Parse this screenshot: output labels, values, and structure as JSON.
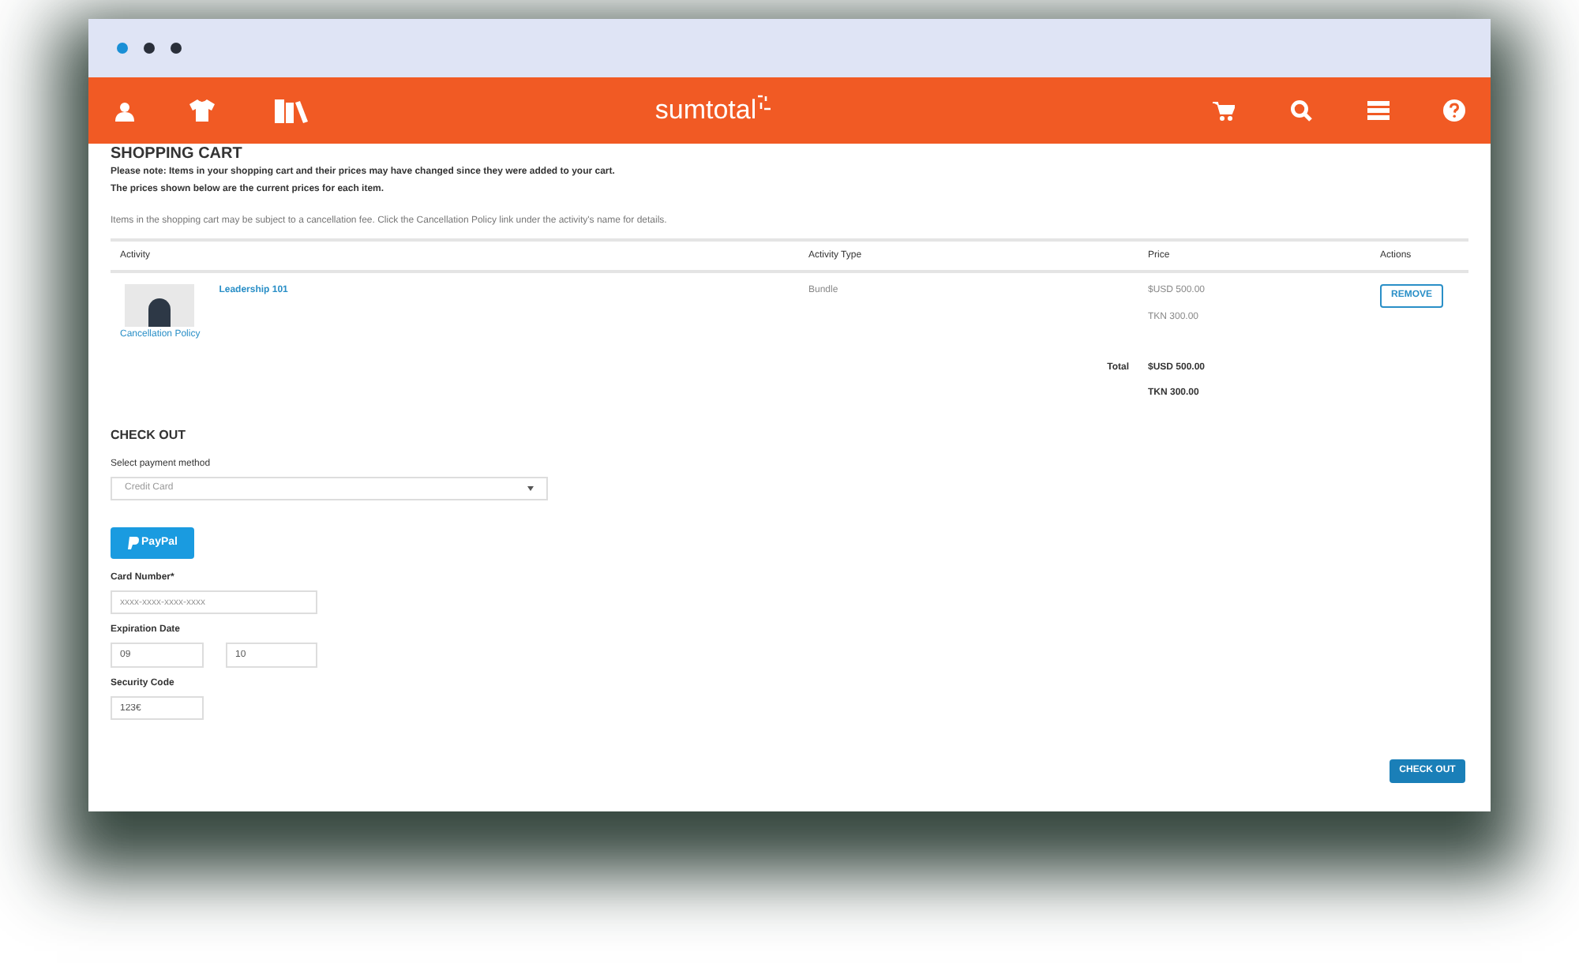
{
  "nav": {
    "logo": "sumtotal"
  },
  "cart": {
    "title": "SHOPPING CART",
    "notes": [
      "Please note: Items in your shopping cart and their prices may have changed since they were added to your cart.",
      "The prices shown below are the current prices for each item."
    ],
    "fee_note": "Items in the shopping cart may be subject to a cancellation fee. Click the Cancellation Policy link under the activity's name for details.",
    "columns": [
      "Activity",
      "Activity Type",
      "Price",
      "Actions"
    ],
    "rows": [
      {
        "name": "Leadership 101",
        "policy": "Cancellation Policy",
        "type": "Bundle",
        "prices": [
          "$USD 500.00",
          "TKN 300.00"
        ],
        "action": "REMOVE"
      }
    ],
    "total_label": "Total",
    "totals": [
      "$USD 500.00",
      "TKN 300.00"
    ]
  },
  "checkout": {
    "title": "CHECK OUT",
    "method_label": "Select payment method",
    "method": "Credit Card",
    "paypal": "PayPal",
    "card_label": "Card Number*",
    "card_placeholder": "xxxx-xxxx-xxxx-xxxx",
    "exp_label": "Expiration Date",
    "exp_month": "09",
    "exp_year": "10",
    "code_label": "Security Code",
    "code": "123€",
    "button": "CHECK OUT"
  }
}
